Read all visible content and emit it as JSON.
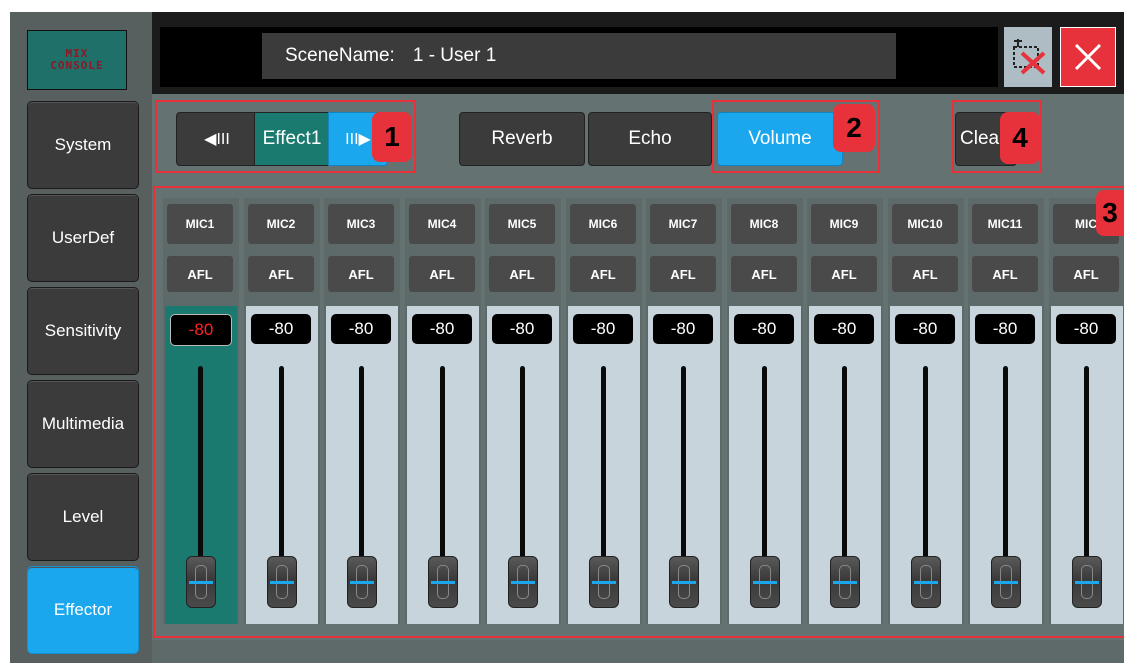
{
  "logo": {
    "text": "MIX\nCONSOLE"
  },
  "sidebar": {
    "items": [
      {
        "label": "System"
      },
      {
        "label": "UserDef"
      },
      {
        "label": "Sensitivity"
      },
      {
        "label": "Multimedia"
      },
      {
        "label": "Level"
      },
      {
        "label": "Effector",
        "active": true
      }
    ]
  },
  "header": {
    "scene_label": "SceneName:",
    "scene_value": "1 - User 1"
  },
  "toolbar": {
    "prev_icon": "◀III",
    "effect_label": "Effect1",
    "next_icon": "III▶",
    "reverb_label": "Reverb",
    "echo_label": "Echo",
    "volume_label": "Volume",
    "clear_label": "Clea"
  },
  "annotations": {
    "b1": "1",
    "b2": "2",
    "b3": "3",
    "b4": "4"
  },
  "channels": [
    {
      "name": "MIC1",
      "afl": "AFL",
      "value": "-80",
      "selected": true
    },
    {
      "name": "MIC2",
      "afl": "AFL",
      "value": "-80"
    },
    {
      "name": "MIC3",
      "afl": "AFL",
      "value": "-80"
    },
    {
      "name": "MIC4",
      "afl": "AFL",
      "value": "-80"
    },
    {
      "name": "MIC5",
      "afl": "AFL",
      "value": "-80"
    },
    {
      "name": "MIC6",
      "afl": "AFL",
      "value": "-80"
    },
    {
      "name": "MIC7",
      "afl": "AFL",
      "value": "-80"
    },
    {
      "name": "MIC8",
      "afl": "AFL",
      "value": "-80"
    },
    {
      "name": "MIC9",
      "afl": "AFL",
      "value": "-80"
    },
    {
      "name": "MIC10",
      "afl": "AFL",
      "value": "-80"
    },
    {
      "name": "MIC11",
      "afl": "AFL",
      "value": "-80"
    },
    {
      "name": "MIC",
      "afl": "AFL",
      "value": "-80"
    }
  ],
  "colors": {
    "accent": "#1aa7ee",
    "annotation": "#e8323b",
    "selected_strip": "#1b7a70"
  }
}
